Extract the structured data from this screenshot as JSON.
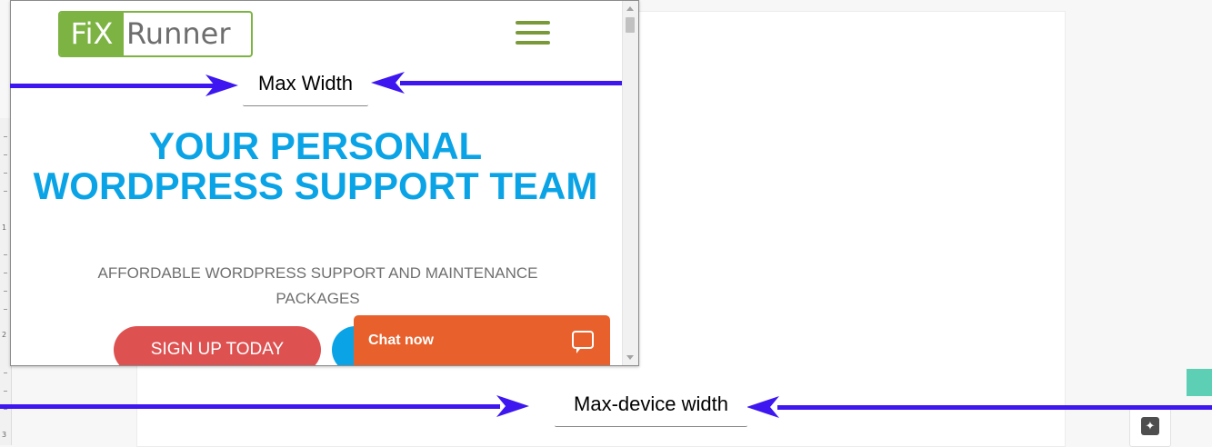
{
  "site": {
    "logo": {
      "part1": "FiX",
      "part2": "Runner"
    },
    "hero_title": "YOUR PERSONAL WORDPRESS SUPPORT TEAM",
    "hero_subtitle": "AFFORDABLE WORDPRESS SUPPORT AND MAINTENANCE PACKAGES",
    "signup_button": "SIGN UP TODAY",
    "chat_label": "Chat now"
  },
  "annotations": {
    "max_width_label": "Max Width",
    "max_device_width_label": "Max-device width"
  },
  "ruler_numbers": [
    "1",
    "2",
    "3"
  ],
  "colors": {
    "logo_green": "#7cb342",
    "hero_blue": "#0aa4e6",
    "signup_red": "#de5151",
    "chat_orange": "#e8602b",
    "arrow_purple": "#3d16f0",
    "teal": "#5ccfb4"
  }
}
